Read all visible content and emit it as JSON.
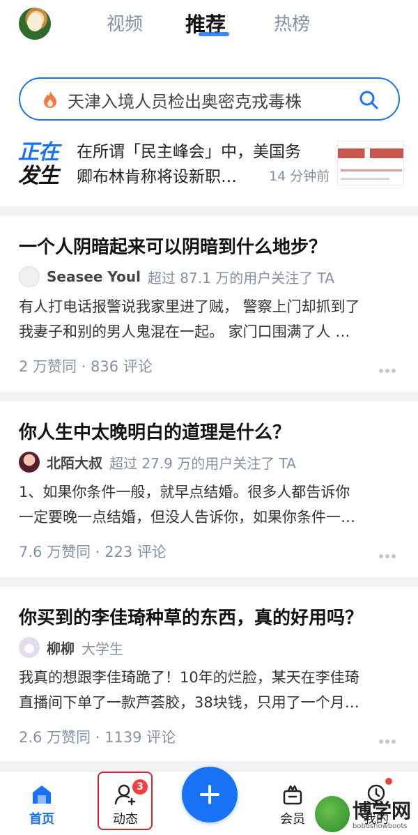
{
  "top_nav": {
    "tabs": [
      {
        "label": "视频",
        "active": false
      },
      {
        "label": "推荐",
        "active": true
      },
      {
        "label": "热榜",
        "active": false
      }
    ],
    "accent_color": "#1772f6"
  },
  "search": {
    "value": "天津入境人员检出奥密克戎毒株",
    "icon_left": "hot-flame-icon",
    "icon_right": "search-icon"
  },
  "happening_now": {
    "logo_line1": "正在",
    "logo_line2": "发生",
    "text_line1": "在所谓「民主峰会」中，美国务",
    "text_line2": "卿布林肯称将设新职…",
    "time": "14 分钟前"
  },
  "feed": [
    {
      "title": "一个人阴暗起来可以阴暗到什么地步？",
      "author": "Seasee Youl",
      "author_meta": "超过 87.1 万的用户关注了 TA",
      "excerpt_line1": "有人打电话报警说我家里进了贼， 警察上门却抓到了",
      "excerpt_line2": "我妻子和别的男人鬼混在一起。 家门口围满了人 …",
      "stats": "2 万赞同 · 836 评论"
    },
    {
      "title": "你人生中太晚明白的道理是什么？",
      "author": "北陌大叔",
      "author_meta": "超过 27.9 万的用户关注了 TA",
      "excerpt_line1": "1、如果你条件一般，就早点结婚。很多人都告诉你",
      "excerpt_line2": "一定要晚一点结婚，但没人告诉你，如果你条件一…",
      "stats": "7.6 万赞同 · 223 评论"
    },
    {
      "title": "你买到的李佳琦种草的东西，真的好用吗？",
      "author": "柳柳",
      "author_meta": "大学生",
      "excerpt_line1": "我真的想跟李佳琦跪了！10年的烂脸，某天在李佳琦",
      "excerpt_line2": "直播间下单了一款芦荟胶，38块钱，只用了一个月…",
      "stats": "2.6 万赞同 · 1139 评论"
    }
  ],
  "bottom_bar": {
    "home": "首页",
    "activity": "动态",
    "activity_badge": "3",
    "vip": "会员",
    "me": "我的"
  },
  "watermark": {
    "text": "博学网",
    "sub": "bobosnowboots"
  }
}
